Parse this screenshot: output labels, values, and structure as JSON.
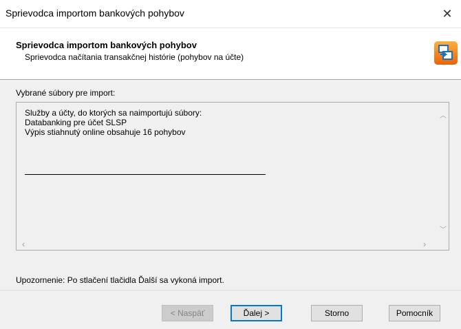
{
  "window": {
    "title": "Sprievodca importom bankových pohybov",
    "close_glyph": "✕"
  },
  "header": {
    "title": "Sprievodca importom bankových pohybov",
    "subtitle": "Sprievodca načítania transakčnej histórie (pohybov na účte)",
    "icon": "wizard-logo-icon",
    "icon_colors": {
      "orange": "#f5820d",
      "blue": "#1f6fb4"
    }
  },
  "content": {
    "selected_files_label": "Vybrané súbory pre import:",
    "summary_lines": [
      "Služby a účty, do ktorých sa naimportujú súbory:",
      "Databanking pre účet SLSP",
      "Výpis stiahnutý online obsahuje 16 pohybov"
    ],
    "warning": "Upozornenie: Po stlačení tlačidla Ďalší sa vykoná import."
  },
  "buttons": {
    "back": "< Naspäť",
    "next": "Ďalej >",
    "cancel": "Storno",
    "help": "Pomocník"
  }
}
